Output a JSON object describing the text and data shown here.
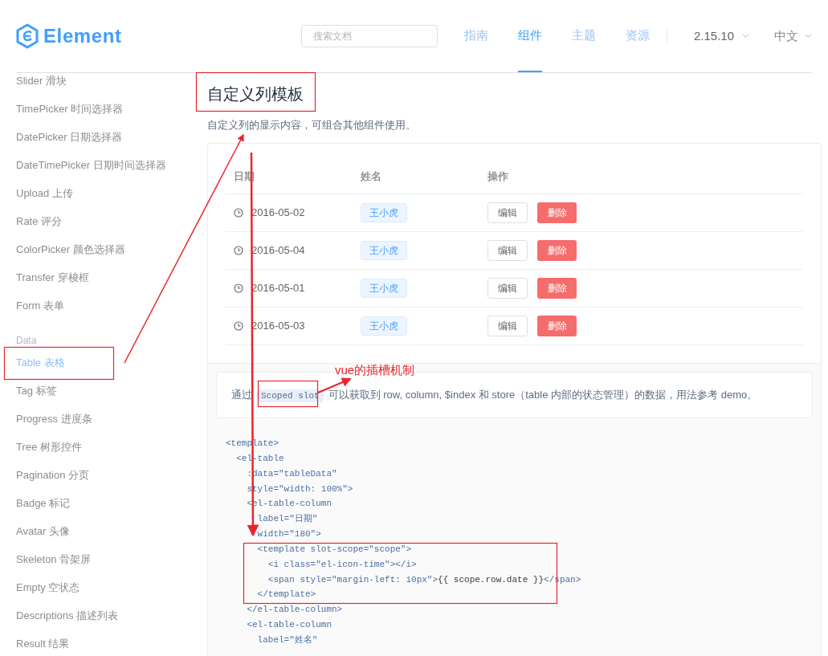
{
  "header": {
    "logo_text": "Element",
    "search": {
      "placeholder": "搜索文档"
    },
    "nav": [
      {
        "label": "指南",
        "selected": false
      },
      {
        "label": "组件",
        "selected": true
      },
      {
        "label": "主题",
        "selected": false
      },
      {
        "label": "资源",
        "selected": false
      }
    ],
    "version": "2.15.10",
    "language": "中文"
  },
  "sidebar": {
    "items": [
      {
        "kind": "item",
        "label": "Slider 滑块",
        "selected": false
      },
      {
        "kind": "item",
        "label": "TimePicker 时间选择器",
        "selected": false
      },
      {
        "kind": "item",
        "label": "DatePicker 日期选择器",
        "selected": false
      },
      {
        "kind": "item",
        "label": "DateTimePicker 日期时间选择器",
        "selected": false
      },
      {
        "kind": "item",
        "label": "Upload 上传",
        "selected": false
      },
      {
        "kind": "item",
        "label": "Rate 评分",
        "selected": false
      },
      {
        "kind": "item",
        "label": "ColorPicker 颜色选择器",
        "selected": false
      },
      {
        "kind": "item",
        "label": "Transfer 穿梭框",
        "selected": false
      },
      {
        "kind": "item",
        "label": "Form 表单",
        "selected": false
      },
      {
        "kind": "group",
        "label": "Data"
      },
      {
        "kind": "item",
        "label": "Table 表格",
        "selected": true
      },
      {
        "kind": "item",
        "label": "Tag 标签",
        "selected": false
      },
      {
        "kind": "item",
        "label": "Progress 进度条",
        "selected": false
      },
      {
        "kind": "item",
        "label": "Tree 树形控件",
        "selected": false
      },
      {
        "kind": "item",
        "label": "Pagination 分页",
        "selected": false
      },
      {
        "kind": "item",
        "label": "Badge 标记",
        "selected": false
      },
      {
        "kind": "item",
        "label": "Avatar 头像",
        "selected": false
      },
      {
        "kind": "item",
        "label": "Skeleton 骨架屏",
        "selected": false
      },
      {
        "kind": "item",
        "label": "Empty 空状态",
        "selected": false
      },
      {
        "kind": "item",
        "label": "Descriptions 描述列表",
        "selected": false
      },
      {
        "kind": "item",
        "label": "Result 结果",
        "selected": false
      }
    ]
  },
  "content": {
    "title": "自定义列模板",
    "description": "自定义列的显示内容，可组合其他组件使用。",
    "table": {
      "columns": [
        "日期",
        "姓名",
        "操作"
      ],
      "rows": [
        {
          "date": "2016-05-02",
          "name": "王小虎",
          "edit": "编辑",
          "delete": "删除"
        },
        {
          "date": "2016-05-04",
          "name": "王小虎",
          "edit": "编辑",
          "delete": "删除"
        },
        {
          "date": "2016-05-01",
          "name": "王小虎",
          "edit": "编辑",
          "delete": "删除"
        },
        {
          "date": "2016-05-03",
          "name": "王小虎",
          "edit": "编辑",
          "delete": "删除"
        }
      ]
    },
    "note": {
      "before": "通过",
      "code": "Scoped slot",
      "after": "可以获取到 row, column, $index 和 store（table 内部的状态管理）的数据，用法参考 demo。"
    },
    "code_lines": [
      [
        {
          "kind": "tag",
          "text": "<template>"
        }
      ],
      [
        {
          "kind": "tag",
          "text": "  <el-table"
        }
      ],
      [
        {
          "kind": "tag",
          "text": "    :data=\"tableData\""
        }
      ],
      [
        {
          "kind": "tag",
          "text": "    style=\"width: 100%\">"
        }
      ],
      [
        {
          "kind": "tag",
          "text": "    <el-table-column"
        }
      ],
      [
        {
          "kind": "tag",
          "text": "      label=\"日期\""
        }
      ],
      [
        {
          "kind": "tag",
          "text": "      width=\"180\">"
        }
      ],
      [
        {
          "kind": "tag",
          "text": "      <template slot-scope=\"scope\">"
        }
      ],
      [
        {
          "kind": "tag",
          "text": "        <i class=\"el-icon-time\"></i>"
        }
      ],
      [
        {
          "kind": "tag",
          "text": "        <span style=\"margin-left: 10px\">"
        },
        {
          "kind": "text",
          "text": "{{ scope.row.date }}"
        },
        {
          "kind": "tag",
          "text": "</span>"
        }
      ],
      [
        {
          "kind": "tag",
          "text": "      </template>"
        }
      ],
      [
        {
          "kind": "tag",
          "text": "    </el-table-column>"
        }
      ],
      [
        {
          "kind": "tag",
          "text": "    <el-table-column"
        }
      ],
      [
        {
          "kind": "tag",
          "text": "      label=\"姓名\""
        }
      ]
    ]
  },
  "annotation_label": "vue的插槽机制"
}
